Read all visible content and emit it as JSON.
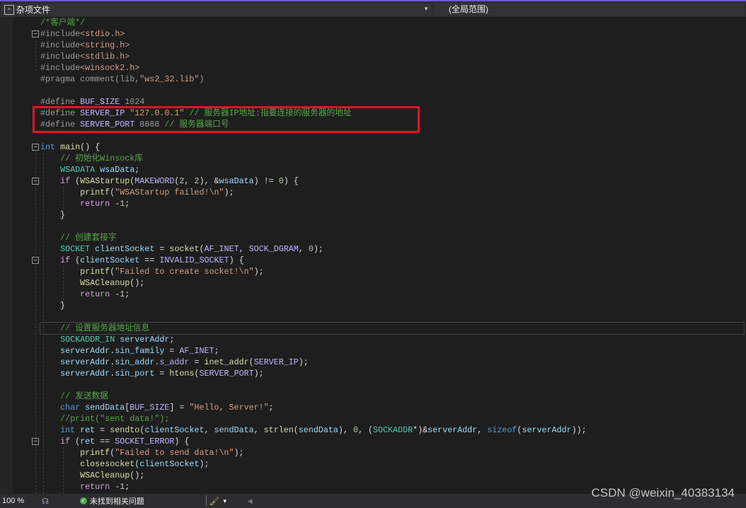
{
  "navbar": {
    "file": "杂项文件",
    "scope": "(全局范围)"
  },
  "status": {
    "zoom": "100 %",
    "issues": "未找到相关问题"
  },
  "watermark": "CSDN @weixin_40383134",
  "colors": {
    "highlight_box": "#e81123",
    "background": "#1e1e1e"
  },
  "code": {
    "lines": [
      [
        [
          "c",
          "/*客户端*/"
        ]
      ],
      [
        [
          "p",
          "#include"
        ],
        [
          "s",
          "<stdio.h>"
        ]
      ],
      [
        [
          "p",
          "#include"
        ],
        [
          "s",
          "<string.h>"
        ]
      ],
      [
        [
          "p",
          "#include"
        ],
        [
          "s",
          "<stdlib.h>"
        ]
      ],
      [
        [
          "p",
          "#include"
        ],
        [
          "s",
          "<winsock2.h>"
        ]
      ],
      [
        [
          "p",
          "#pragma comment(lib,"
        ],
        [
          "s",
          "\"ws2_32.lib\""
        ],
        [
          "p",
          ")"
        ]
      ],
      [],
      [
        [
          "p",
          "#define "
        ],
        [
          "m",
          "BUF_SIZE"
        ],
        [
          "p",
          " 1024"
        ]
      ],
      [
        [
          "p",
          "#define "
        ],
        [
          "m",
          "SERVER_IP"
        ],
        [
          "p",
          " "
        ],
        [
          "s",
          "\"127.0.0.1\""
        ],
        [
          "p",
          " "
        ],
        [
          "c",
          "// 服务器IP地址:指要连接的服务器的地址"
        ]
      ],
      [
        [
          "p",
          "#define "
        ],
        [
          "m",
          "SERVER_PORT"
        ],
        [
          "p",
          " 8888 "
        ],
        [
          "c",
          "// 服务器端口号"
        ]
      ],
      [],
      [
        [
          "k",
          "int"
        ],
        [
          "o",
          " "
        ],
        [
          "f",
          "main"
        ],
        [
          "o",
          "() {"
        ]
      ],
      [
        [
          "o",
          "    "
        ],
        [
          "c",
          "// 初始化Winsock库"
        ]
      ],
      [
        [
          "o",
          "    "
        ],
        [
          "t",
          "WSADATA"
        ],
        [
          "o",
          " "
        ],
        [
          "v",
          "wsaData"
        ],
        [
          "o",
          ";"
        ]
      ],
      [
        [
          "o",
          "    "
        ],
        [
          "r",
          "if"
        ],
        [
          "o",
          " ("
        ],
        [
          "f",
          "WSAStartup"
        ],
        [
          "o",
          "("
        ],
        [
          "m",
          "MAKEWORD"
        ],
        [
          "o",
          "("
        ],
        [
          "n",
          "2"
        ],
        [
          "o",
          ", "
        ],
        [
          "n",
          "2"
        ],
        [
          "o",
          "), &"
        ],
        [
          "v",
          "wsaData"
        ],
        [
          "o",
          ") != "
        ],
        [
          "n",
          "0"
        ],
        [
          "o",
          ") {"
        ]
      ],
      [
        [
          "o",
          "        "
        ],
        [
          "f",
          "printf"
        ],
        [
          "o",
          "("
        ],
        [
          "s",
          "\"WSAStartup failed!\\n\""
        ],
        [
          "o",
          ");"
        ]
      ],
      [
        [
          "o",
          "        "
        ],
        [
          "r",
          "return"
        ],
        [
          "o",
          " -"
        ],
        [
          "n",
          "1"
        ],
        [
          "o",
          ";"
        ]
      ],
      [
        [
          "o",
          "    }"
        ]
      ],
      [],
      [
        [
          "o",
          "    "
        ],
        [
          "c",
          "// 创建套接字"
        ]
      ],
      [
        [
          "o",
          "    "
        ],
        [
          "t",
          "SOCKET"
        ],
        [
          "o",
          " "
        ],
        [
          "v",
          "clientSocket"
        ],
        [
          "o",
          " = "
        ],
        [
          "f",
          "socket"
        ],
        [
          "o",
          "("
        ],
        [
          "m",
          "AF_INET"
        ],
        [
          "o",
          ", "
        ],
        [
          "m",
          "SOCK_DGRAM"
        ],
        [
          "o",
          ", "
        ],
        [
          "n",
          "0"
        ],
        [
          "o",
          ");"
        ]
      ],
      [
        [
          "o",
          "    "
        ],
        [
          "r",
          "if"
        ],
        [
          "o",
          " ("
        ],
        [
          "v",
          "clientSocket"
        ],
        [
          "o",
          " == "
        ],
        [
          "m",
          "INVALID_SOCKET"
        ],
        [
          "o",
          ") {"
        ]
      ],
      [
        [
          "o",
          "        "
        ],
        [
          "f",
          "printf"
        ],
        [
          "o",
          "("
        ],
        [
          "s",
          "\"Failed to create socket!\\n\""
        ],
        [
          "o",
          ");"
        ]
      ],
      [
        [
          "o",
          "        "
        ],
        [
          "f",
          "WSACleanup"
        ],
        [
          "o",
          "();"
        ]
      ],
      [
        [
          "o",
          "        "
        ],
        [
          "r",
          "return"
        ],
        [
          "o",
          " -"
        ],
        [
          "n",
          "1"
        ],
        [
          "o",
          ";"
        ]
      ],
      [
        [
          "o",
          "    }"
        ]
      ],
      [],
      [
        [
          "o",
          "    "
        ],
        [
          "c",
          "// 设置服务器地址信息"
        ]
      ],
      [
        [
          "o",
          "    "
        ],
        [
          "t",
          "SOCKADDR_IN"
        ],
        [
          "o",
          " "
        ],
        [
          "v",
          "serverAddr"
        ],
        [
          "o",
          ";"
        ]
      ],
      [
        [
          "o",
          "    "
        ],
        [
          "v",
          "serverAddr"
        ],
        [
          "o",
          "."
        ],
        [
          "v",
          "sin_family"
        ],
        [
          "o",
          " = "
        ],
        [
          "m",
          "AF_INET"
        ],
        [
          "o",
          ";"
        ]
      ],
      [
        [
          "o",
          "    "
        ],
        [
          "v",
          "serverAddr"
        ],
        [
          "o",
          "."
        ],
        [
          "v",
          "sin_addr"
        ],
        [
          "o",
          "."
        ],
        [
          "m",
          "s_addr"
        ],
        [
          "o",
          " = "
        ],
        [
          "f",
          "inet_addr"
        ],
        [
          "o",
          "("
        ],
        [
          "m",
          "SERVER_IP"
        ],
        [
          "o",
          ");"
        ]
      ],
      [
        [
          "o",
          "    "
        ],
        [
          "v",
          "serverAddr"
        ],
        [
          "o",
          "."
        ],
        [
          "v",
          "sin_port"
        ],
        [
          "o",
          " = "
        ],
        [
          "f",
          "htons"
        ],
        [
          "o",
          "("
        ],
        [
          "m",
          "SERVER_PORT"
        ],
        [
          "o",
          ");"
        ]
      ],
      [],
      [
        [
          "o",
          "    "
        ],
        [
          "c",
          "// 发送数据"
        ]
      ],
      [
        [
          "o",
          "    "
        ],
        [
          "k",
          "char"
        ],
        [
          "o",
          " "
        ],
        [
          "v",
          "sendData"
        ],
        [
          "o",
          "["
        ],
        [
          "m",
          "BUF_SIZE"
        ],
        [
          "o",
          "] = "
        ],
        [
          "s",
          "\"Hello, Server!\""
        ],
        [
          "o",
          ";"
        ]
      ],
      [
        [
          "o",
          "    "
        ],
        [
          "c",
          "//print(\"sent data!\");"
        ]
      ],
      [
        [
          "o",
          "    "
        ],
        [
          "k",
          "int"
        ],
        [
          "o",
          " "
        ],
        [
          "v",
          "ret"
        ],
        [
          "o",
          " = "
        ],
        [
          "f",
          "sendto"
        ],
        [
          "o",
          "("
        ],
        [
          "v",
          "clientSocket"
        ],
        [
          "o",
          ", "
        ],
        [
          "v",
          "sendData"
        ],
        [
          "o",
          ", "
        ],
        [
          "f",
          "strlen"
        ],
        [
          "o",
          "("
        ],
        [
          "v",
          "sendData"
        ],
        [
          "o",
          "), "
        ],
        [
          "n",
          "0"
        ],
        [
          "o",
          ", ("
        ],
        [
          "t",
          "SOCKADDR"
        ],
        [
          "o",
          "*)&"
        ],
        [
          "v",
          "serverAddr"
        ],
        [
          "o",
          ", "
        ],
        [
          "k",
          "sizeof"
        ],
        [
          "o",
          "("
        ],
        [
          "v",
          "serverAddr"
        ],
        [
          "o",
          "));"
        ]
      ],
      [
        [
          "o",
          "    "
        ],
        [
          "r",
          "if"
        ],
        [
          "o",
          " ("
        ],
        [
          "v",
          "ret"
        ],
        [
          "o",
          " == "
        ],
        [
          "m",
          "SOCKET_ERROR"
        ],
        [
          "o",
          ") {"
        ]
      ],
      [
        [
          "o",
          "        "
        ],
        [
          "f",
          "printf"
        ],
        [
          "o",
          "("
        ],
        [
          "s",
          "\"Failed to send data!\\n\""
        ],
        [
          "o",
          ");"
        ]
      ],
      [
        [
          "o",
          "        "
        ],
        [
          "f",
          "closesocket"
        ],
        [
          "o",
          "("
        ],
        [
          "v",
          "clientSocket"
        ],
        [
          "o",
          ");"
        ]
      ],
      [
        [
          "o",
          "        "
        ],
        [
          "f",
          "WSACleanup"
        ],
        [
          "o",
          "();"
        ]
      ],
      [
        [
          "o",
          "        "
        ],
        [
          "r",
          "return"
        ],
        [
          "o",
          " -"
        ],
        [
          "n",
          "1"
        ],
        [
          "o",
          ";"
        ]
      ]
    ]
  }
}
